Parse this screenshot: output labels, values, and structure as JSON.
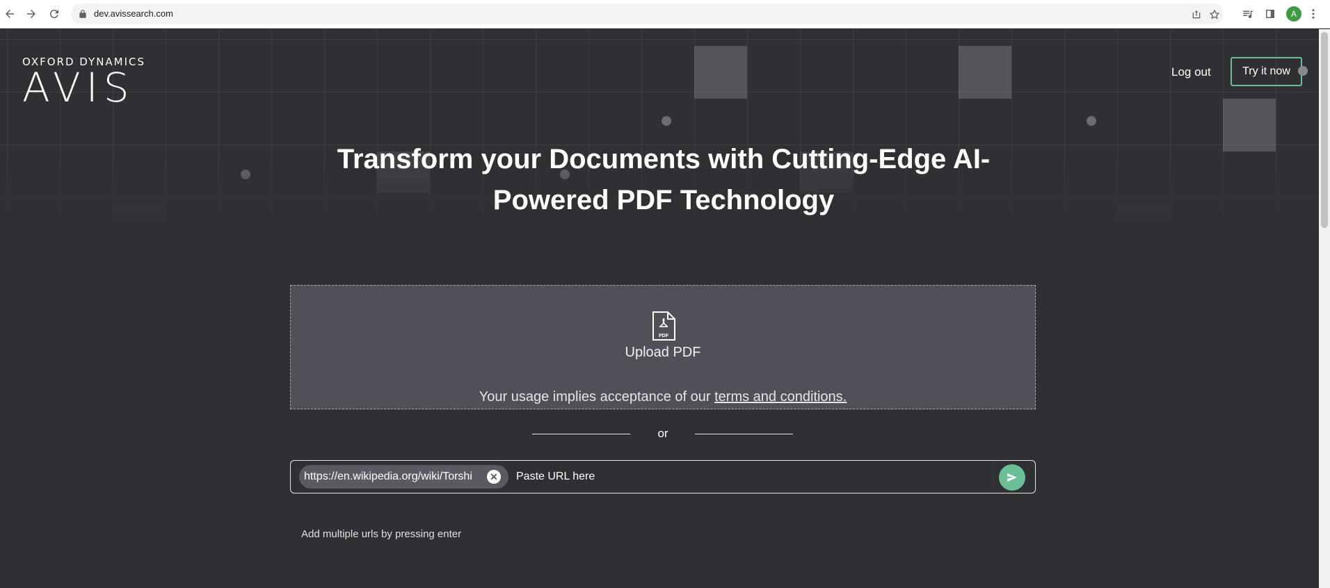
{
  "browser": {
    "url": "dev.avissearch.com",
    "avatar_letter": "A"
  },
  "header": {
    "logo_small": "OXFORD DYNAMICS",
    "logo_big": "AVIS",
    "logout_label": "Log out",
    "try_label": "Try it now"
  },
  "hero": {
    "headline_line1": "Transform your Documents with Cutting-Edge AI-",
    "headline_line2": "Powered PDF Technology"
  },
  "upload": {
    "label": "Upload PDF",
    "terms_prefix": "Your usage implies acceptance of our ",
    "terms_link": "terms and conditions."
  },
  "divider": {
    "or": "or"
  },
  "url_entry": {
    "chip_value": "https://en.wikipedia.org/wiki/Torshi",
    "placeholder": "Paste URL here",
    "hint": "Add multiple urls by pressing enter"
  },
  "colors": {
    "accent": "#6bbf97",
    "background": "#2f3034",
    "upload_panel": "#4f5058"
  }
}
